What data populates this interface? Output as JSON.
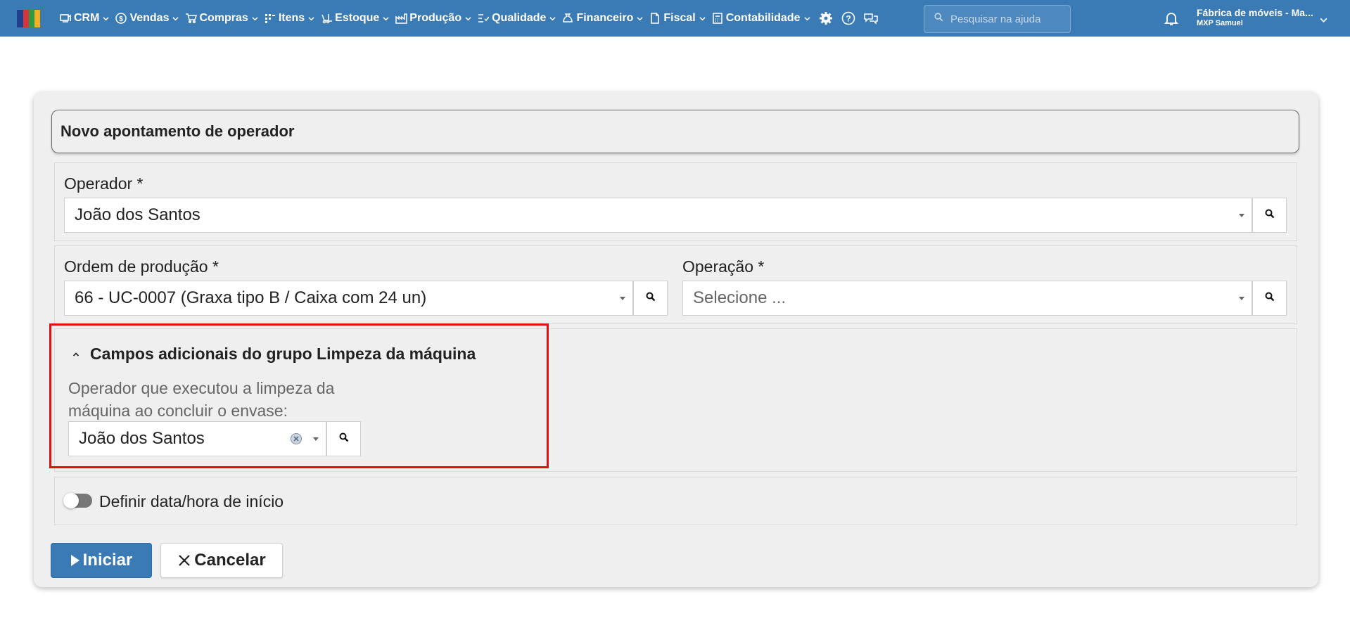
{
  "nav": {
    "menu": [
      {
        "label": "CRM",
        "icon": "crm-icon"
      },
      {
        "label": "Vendas",
        "icon": "dollar-icon"
      },
      {
        "label": "Compras",
        "icon": "cart-icon"
      },
      {
        "label": "Itens",
        "icon": "items-icon"
      },
      {
        "label": "Estoque",
        "icon": "forklift-icon"
      },
      {
        "label": "Produção",
        "icon": "factory-icon"
      },
      {
        "label": "Qualidade",
        "icon": "checklist-icon"
      },
      {
        "label": "Financeiro",
        "icon": "money-bag-icon"
      },
      {
        "label": "Fiscal",
        "icon": "document-icon"
      },
      {
        "label": "Contabilidade",
        "icon": "calculator-icon"
      }
    ],
    "search_placeholder": "Pesquisar na ajuda",
    "company_name": "Fábrica de móveis - Ma...",
    "company_user": "MXP Samuel"
  },
  "form": {
    "title": "Novo apontamento de operador",
    "operador": {
      "label": "Operador *",
      "value": "João dos Santos"
    },
    "ordem": {
      "label": "Ordem de produção *",
      "value": "66 - UC-0007 (Graxa tipo B / Caixa com 24 un)"
    },
    "operacao": {
      "label": "Operação *",
      "placeholder": "Selecione ..."
    },
    "extra_group": {
      "title": "Campos adicionais do grupo Limpeza da máquina",
      "field_label": "Operador que executou a limpeza da máquina ao concluir o envase:",
      "value": "João dos Santos"
    },
    "toggle_label": "Definir data/hora de início",
    "start_label": "Iniciar",
    "cancel_label": "Cancelar"
  },
  "colors": {
    "navbar": "#3a7ab5",
    "highlight": "#e01010",
    "primary_button": "#3a7ab5"
  }
}
